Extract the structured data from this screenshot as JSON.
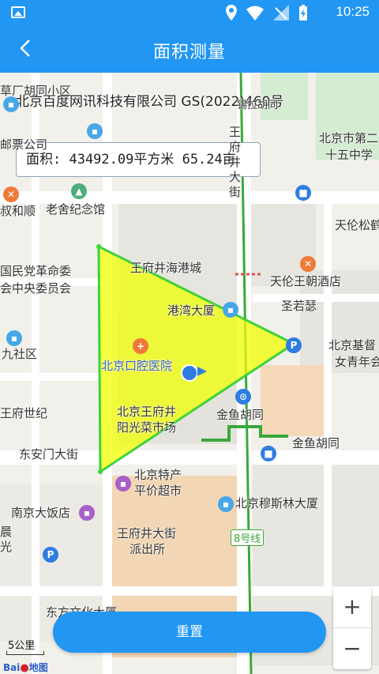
{
  "status_bar": {
    "time": "10:25"
  },
  "header": {
    "title": "面积测量"
  },
  "map": {
    "copyright": "北京百度网讯科技有限公司 GS(2022)460号",
    "labels": [
      "草厂胡同小区",
      "邮票公司",
      "叔和顺",
      "老舍纪念馆",
      "国民党革命委",
      "会中央委员会",
      "九社区",
      "王府世纪",
      "东安门大街",
      "南京大饭店",
      "晨光",
      "东方文化大厦",
      "王府井海港城",
      "港湾大厦",
      "北京口腔医院",
      "北京王府井",
      "阳光菜市场",
      "金鱼胡同",
      "北京特产",
      "平价超市",
      "王府井大街",
      "派出所",
      "北京穆斯林大厦",
      "8号线",
      "天伦王朝酒店",
      "圣若瑟",
      "北京基督",
      "女青年会",
      "天伦松鹤",
      "北京市第二",
      "十五中学",
      "王府井大街",
      "金鱼胡同",
      "锡拉胡同"
    ],
    "scale": "5公里",
    "logo_a": "Bai",
    "logo_b": "地图"
  },
  "measurement": {
    "area_text": "面积: 43492.09平方米 65.24亩"
  },
  "controls": {
    "zoom_in": "+",
    "zoom_out": "−",
    "reset_label": "重置"
  },
  "colors": {
    "primary": "#2196f3",
    "polygon_fill": "#f0ff00",
    "polygon_stroke": "#3cd23c",
    "metro_line": "#3aa83a"
  }
}
